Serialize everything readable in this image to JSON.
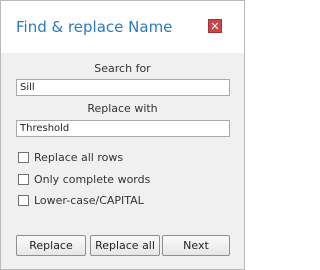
{
  "dialog": {
    "title": "Find & replace Name",
    "close_icon": "close-icon"
  },
  "search": {
    "label": "Search for",
    "value": "Sill"
  },
  "replace": {
    "label": "Replace with",
    "value": "Threshold"
  },
  "options": [
    {
      "label": "Replace all rows",
      "checked": false
    },
    {
      "label": "Only complete words",
      "checked": false
    },
    {
      "label": "Lower-case/CAPITAL",
      "checked": false
    }
  ],
  "buttons": {
    "replace": "Replace",
    "replace_all": "Replace all",
    "next": "Next"
  },
  "colors": {
    "title": "#2a79c7",
    "close_background": "#c7484c"
  }
}
